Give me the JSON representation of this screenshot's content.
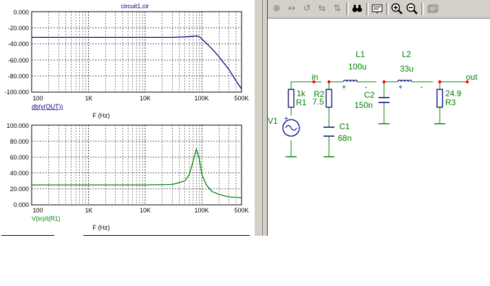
{
  "plot": {
    "title": "circuit1.cir",
    "top": {
      "y_ticks": [
        "0.000",
        "-20.000",
        "-40.000",
        "-60.000",
        "-80.000",
        "-100.000"
      ],
      "x_ticks": [
        "100",
        "1K",
        "10K",
        "100K",
        "500K"
      ],
      "expr": "db(v(OUT))",
      "xlabel": "F (Hz)"
    },
    "bottom": {
      "y_ticks": [
        "100.000",
        "80.000",
        "60.000",
        "40.000",
        "20.000",
        "0.000"
      ],
      "x_ticks": [
        "100",
        "1K",
        "10K",
        "100K",
        "500K"
      ],
      "expr": "V(in)/I(R1)",
      "xlabel": "F (Hz)"
    }
  },
  "chart_data": [
    {
      "type": "line",
      "title": "circuit1.cir",
      "xlabel": "F (Hz)",
      "ylabel": "",
      "x_scale": "log",
      "xlim": [
        100,
        500000
      ],
      "ylim": [
        -100,
        0
      ],
      "grid": true,
      "color": "#000080",
      "series": [
        {
          "name": "db(v(OUT))",
          "x": [
            100,
            1000,
            10000,
            30000,
            60000,
            80000,
            90000,
            100000,
            150000,
            200000,
            300000,
            400000,
            500000
          ],
          "y": [
            -32,
            -32,
            -32,
            -32,
            -31,
            -30,
            -31,
            -34,
            -46,
            -56,
            -72,
            -86,
            -96
          ]
        }
      ]
    },
    {
      "type": "line",
      "xlabel": "F (Hz)",
      "ylabel": "",
      "x_scale": "log",
      "xlim": [
        100,
        500000
      ],
      "ylim": [
        0,
        100
      ],
      "grid": true,
      "color": "#008000",
      "series": [
        {
          "name": "V(in)/I(R1)",
          "x": [
            100,
            1000,
            10000,
            30000,
            50000,
            60000,
            70000,
            80000,
            90000,
            100000,
            120000,
            150000,
            200000,
            300000,
            500000
          ],
          "y": [
            25,
            25,
            25,
            25.5,
            30,
            38,
            55,
            70,
            58,
            38,
            25,
            17,
            13,
            10,
            9
          ]
        }
      ]
    }
  ],
  "toolbar": {
    "icons": [
      "select-tool-icon",
      "pan-tool-icon",
      "rotate-icon",
      "flip-horizontal-icon",
      "flip-vertical-icon",
      "find-icon",
      "properties-icon",
      "zoom-in-icon",
      "zoom-out-icon",
      "fit-page-icon"
    ],
    "glyphs": [
      "⊕",
      "↔",
      "↺",
      "⇆",
      "⇅",
      "▨",
      "▤",
      "⊕",
      "⊖",
      "▭"
    ]
  },
  "schematic": {
    "labels": [
      "in",
      "out",
      "L1",
      "100u",
      "L2",
      "33u",
      "R2",
      "7.5",
      "1k",
      "R1",
      "V1",
      "C1",
      "68n",
      "C2",
      "150n",
      "24.9",
      "R3"
    ],
    "plus": "+",
    "minus": "-"
  },
  "colors": {
    "wire": "#008000",
    "component": "#000080",
    "node": "#ff0000",
    "label": "#008000",
    "background": "#d4d0c8"
  }
}
